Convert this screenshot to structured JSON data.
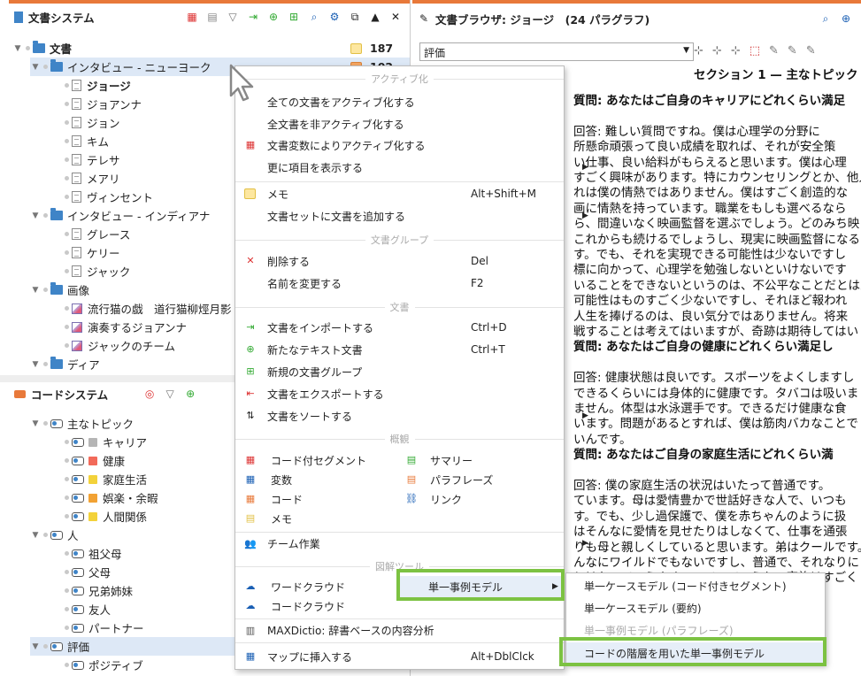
{
  "doc_system": {
    "title": "文書システム",
    "root": "文書",
    "root_count": "187",
    "count2": "102",
    "groups": [
      {
        "name": "インタビュー - ニューヨーク",
        "children": [
          "ジョージ",
          "ジョアンナ",
          "ジョン",
          "キム",
          "テレサ",
          "メアリ",
          "ヴィンセント"
        ]
      },
      {
        "name": "インタビュー - インディアナ",
        "children": [
          "グレース",
          "ケリー",
          "ジャック"
        ]
      },
      {
        "name": "画像",
        "children": [
          "流行猫の戯　道行猫柳烴月影",
          "演奏するジョアンナ",
          "ジャックのチーム"
        ]
      },
      {
        "name": "ディア",
        "children": []
      }
    ]
  },
  "code_system": {
    "title": "コードシステム",
    "items": [
      {
        "label": "主なトピック",
        "level": 1,
        "color": ""
      },
      {
        "label": "キャリア",
        "level": 2,
        "color": "#b5b5b5"
      },
      {
        "label": "健康",
        "level": 2,
        "color": "#f26a5a"
      },
      {
        "label": "家庭生活",
        "level": 2,
        "color": "#f3d23a"
      },
      {
        "label": "娯楽・余暇",
        "level": 2,
        "color": "#f2a233"
      },
      {
        "label": "人間関係",
        "level": 2,
        "color": "#f3d23a"
      },
      {
        "label": "人",
        "level": 1,
        "color": ""
      },
      {
        "label": "祖父母",
        "level": 2,
        "color": ""
      },
      {
        "label": "父母",
        "level": 2,
        "color": ""
      },
      {
        "label": "兄弟姉妹",
        "level": 2,
        "color": ""
      },
      {
        "label": "友人",
        "level": 2,
        "color": ""
      },
      {
        "label": "パートナー",
        "level": 2,
        "color": ""
      },
      {
        "label": "評価",
        "level": 1,
        "color": ""
      },
      {
        "label": "ポジティブ",
        "level": 2,
        "color": ""
      }
    ]
  },
  "browser": {
    "title": "文書ブラウザ: ジョージ　(24 パラグラフ)",
    "dropdown_value": "評価",
    "section_title": "セクション 1 — 主なトピック",
    "lines": [
      {
        "t": "質問: あなたはご自身のキャリアにどれくらい満足",
        "b": true
      },
      {
        "t": "",
        "b": false
      },
      {
        "t": "回答: 難しい質問ですね。僕は心理学の分野に",
        "b": false
      },
      {
        "t": "所懸命頑張って良い成績を取れば、それが安全策",
        "b": false
      },
      {
        "t": "い仕事、良い給料がもらえると思います。僕は心理",
        "b": false
      },
      {
        "t": "すごく興味があります。特にカウンセリングとか、他人",
        "b": false
      },
      {
        "t": "れは僕の情熱ではありません。僕はすごく創造的な",
        "b": false
      },
      {
        "t": "画に情熱を持っています。職業をもしも選べるなら",
        "b": false
      },
      {
        "t": "ら、間違いなく映画監督を選ぶでしょう。どのみち映",
        "b": false
      },
      {
        "t": "これからも続けるでしょうし、現実に映画監督になる",
        "b": false
      },
      {
        "t": "す。でも、それを実現できる可能性は少ないですし",
        "b": false
      },
      {
        "t": "標に向かって、心理学を勉強しないといけないです",
        "b": false
      },
      {
        "t": "いることをできないというのは、不公平なことだとは思",
        "b": false
      },
      {
        "t": "可能性はものすごく少ないですし、それほど報われ",
        "b": false
      },
      {
        "t": "人生を捧げるのは、良い気分ではありません。将来",
        "b": false
      },
      {
        "t": "戦することは考えてはいますが、奇跡は期待してはい",
        "b": false
      },
      {
        "t": "質問: あなたはご自身の健康にどれくらい満足し",
        "b": true
      },
      {
        "t": "",
        "b": false
      },
      {
        "t": "回答: 健康状態は良いです。スポーツをよくしますし",
        "b": false
      },
      {
        "t": "できるくらいには身体的に健康です。タバコは吸いま",
        "b": false
      },
      {
        "t": "ません。体型は水泳選手です。できるだけ健康な食",
        "b": false
      },
      {
        "t": "います。問題があるとすれば、僕は筋肉バカなことで",
        "b": false
      },
      {
        "t": "いんです。",
        "b": false
      },
      {
        "t": "質問: あなたはご自身の家庭生活にどれくらい満",
        "b": true
      },
      {
        "t": "",
        "b": false
      },
      {
        "t": "回答: 僕の家庭生活の状況はいたって普通です。",
        "b": false
      },
      {
        "t": "ています。母は愛情豊かで世話好きな人で、いつも",
        "b": false
      },
      {
        "t": "す。でも、少し過保護で、僕を赤ちゃんのように扱",
        "b": false
      },
      {
        "t": "はそんなに愛情を見せたりはしなくて、仕事を通張",
        "b": false
      },
      {
        "t": "りも母と親しくしていると思います。弟はクールです。",
        "b": false
      },
      {
        "t": "んなにワイルドでもないですし、普通で、それなりに",
        "b": false
      },
      {
        "t": "とはたいていうまくいっていて、うちの家族はすごく",
        "b": false
      }
    ]
  },
  "context_menu": {
    "h1": "アクティブ化",
    "activate_all": "全ての文書をアクティブ化する",
    "deactivate_all": "全文書を非アクティブ化する",
    "activate_by_var": "文書変数によりアクティブ化する",
    "show_more": "更に項目を表示する",
    "memo": "メモ",
    "memo_sc": "Alt+Shift+M",
    "add_to_set": "文書セットに文書を追加する",
    "h2": "文書グループ",
    "delete": "削除する",
    "delete_sc": "Del",
    "rename": "名前を変更する",
    "rename_sc": "F2",
    "h3": "文書",
    "import": "文書をインポートする",
    "import_sc": "Ctrl+D",
    "new_text": "新たなテキスト文書",
    "new_text_sc": "Ctrl+T",
    "new_group": "新規の文書グループ",
    "export": "文書をエクスポートする",
    "sort": "文書をソートする",
    "h4": "概観",
    "coded_seg": "コード付セグメント",
    "summary": "サマリー",
    "variables": "変数",
    "paraphrase": "パラフレーズ",
    "code": "コード",
    "link": "リンク",
    "memo2": "メモ",
    "team": "チーム作業",
    "h5": "図解ツール",
    "word_cloud": "ワードクラウド",
    "single_case": "単一事例モデル",
    "code_cloud": "コードクラウド",
    "maxdictio": "MAXDictio: 辞書ベースの内容分析",
    "insert_map": "マップに挿入する",
    "insert_map_sc": "Alt+DblClck"
  },
  "submenu": {
    "item1": "単一ケースモデル (コード付きセグメント)",
    "item2": "単一ケースモデル (要約)",
    "item3": "単一事例モデル (パラフレーズ)",
    "item4": "コードの階層を用いた単一事例モデル"
  },
  "colors": {
    "accent_orange": "#e8793a",
    "highlight_green": "#7cc242",
    "folder_blue": "#3f84c7",
    "selection": "#dde8f6"
  }
}
